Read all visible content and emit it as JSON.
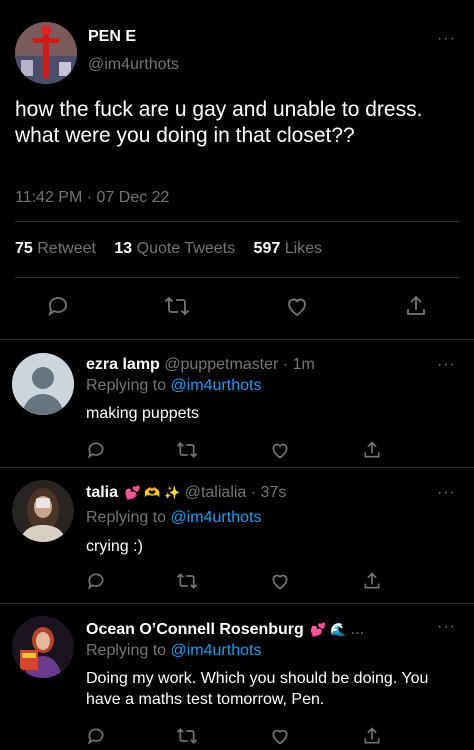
{
  "main_tweet": {
    "name": "PEN E",
    "handle": "@im4urthots",
    "text": "how the fuck are u gay and unable to dress. what were you doing in that closet??",
    "time": "11:42 PM · 07 Dec 22",
    "stats": {
      "retweets": "75",
      "retweets_label": "Retweet",
      "quotes": "13",
      "quotes_label": "Quote Tweets",
      "likes": "597",
      "likes_label": "Likes"
    },
    "more": "···"
  },
  "replies": [
    {
      "name": "ezra lamp",
      "handle": "@puppetmaster",
      "time": "· 1m",
      "replying_prefix": "Replying to",
      "replying_to": "@im4urthots",
      "text": "making puppets",
      "more": "···"
    },
    {
      "name": "talia",
      "emoji": "💕 🫶 ✨",
      "handle": "@talialia",
      "time": "· 37s",
      "replying_prefix": "Replying to",
      "replying_to": "@im4urthots",
      "text": "crying :)",
      "more": "···"
    },
    {
      "name": "Ocean O’Connell Rosenburg",
      "emoji": "💕 🌊",
      "ellipsis": "...",
      "replying_prefix": "Replying to",
      "replying_to": "@im4urthots",
      "text": "Doing my work. Which you should be doing. You have a maths test tomorrow, Pen.",
      "more": "···"
    }
  ],
  "icons": [
    "reply-icon",
    "retweet-icon",
    "like-icon",
    "share-icon"
  ],
  "colors": {
    "background": "#000000",
    "muted": "#71767b",
    "link": "#1d9bf0",
    "text": "#e7e9ea"
  }
}
